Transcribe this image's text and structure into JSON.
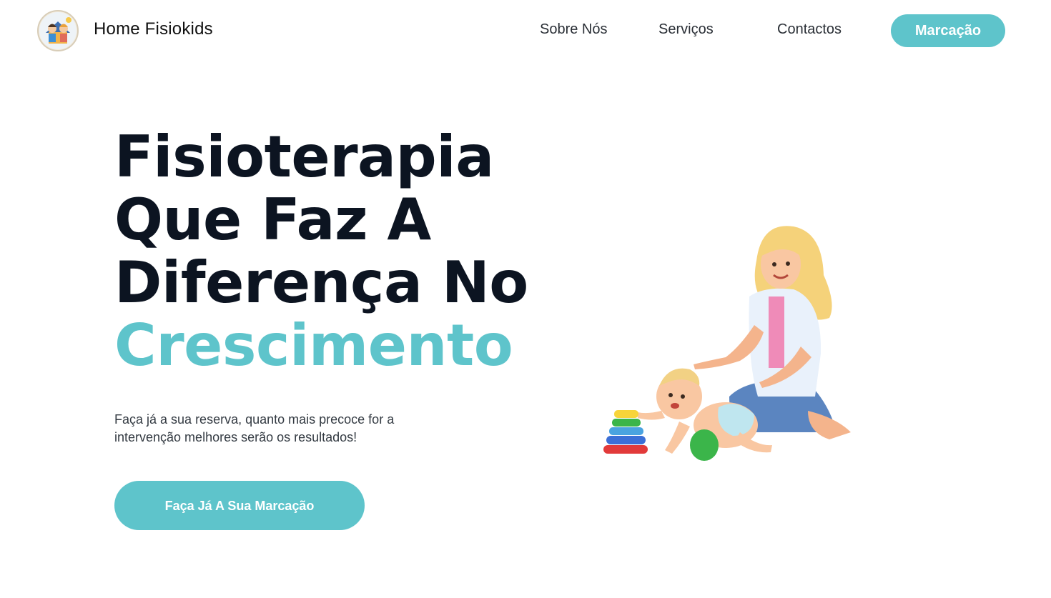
{
  "header": {
    "brand": "Home Fisiokids",
    "nav": [
      {
        "label": "Sobre Nós"
      },
      {
        "label": "Serviços"
      },
      {
        "label": "Contactos"
      }
    ],
    "cta_label": "Marcação"
  },
  "hero": {
    "title_lines": [
      "Fisioterapia",
      "Que Faz A",
      "Diferença No"
    ],
    "title_accent": "Crescimento",
    "subtitle_lines": [
      "Faça já a sua reserva, quanto mais precoce for a",
      "intervenção melhores serão os resultados!"
    ],
    "cta_label": "Faça Já A Sua Marcação"
  },
  "colors": {
    "accent": "#5ec4cb",
    "heading": "#0c1421"
  },
  "icons": {
    "logo": "family-house-logo",
    "illustration": "therapist-with-crawling-baby-illustration"
  }
}
